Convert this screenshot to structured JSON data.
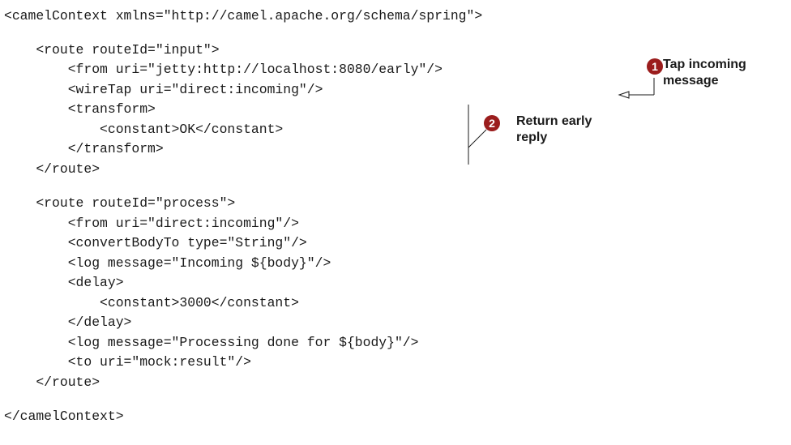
{
  "code": {
    "lines": [
      "<camelContext xmlns=\"http://camel.apache.org/schema/spring\">",
      "    <route routeId=\"input\">",
      "        <from uri=\"jetty:http://localhost:8080/early\"/>",
      "        <wireTap uri=\"direct:incoming\"/>",
      "        <transform>",
      "            <constant>OK</constant>",
      "        </transform>",
      "    </route>",
      "    <route routeId=\"process\">",
      "        <from uri=\"direct:incoming\"/>",
      "        <convertBodyTo type=\"String\"/>",
      "        <log message=\"Incoming ${body}\"/>",
      "        <delay>",
      "            <constant>3000</constant>",
      "        </delay>",
      "        <log message=\"Processing done for ${body}\"/>",
      "        <to uri=\"mock:result\"/>",
      "    </route>",
      "</camelContext>"
    ]
  },
  "callouts": [
    {
      "number": "1",
      "text": "Tap incoming\nmessage"
    },
    {
      "number": "2",
      "text": "Return early\nreply"
    }
  ],
  "colors": {
    "marker": "#9b1d1d",
    "text": "#1a1a1a"
  }
}
